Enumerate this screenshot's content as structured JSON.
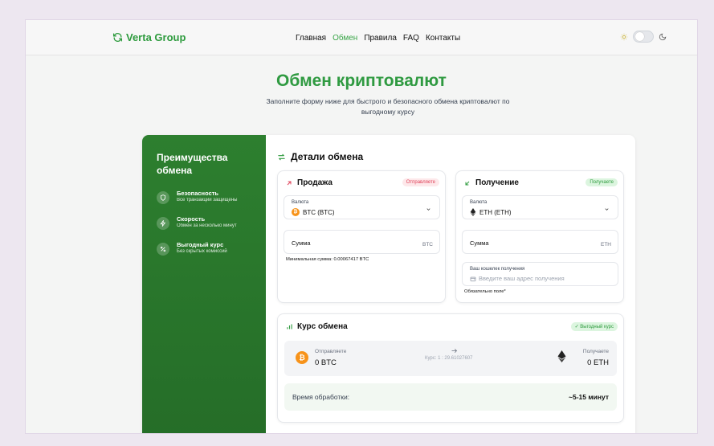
{
  "brand": {
    "name": "Verta Group",
    "color": "#2e9b3e"
  },
  "nav": {
    "items": [
      "Главная",
      "Обмен",
      "Правила",
      "FAQ",
      "Контакты"
    ],
    "active": "Обмен"
  },
  "hero": {
    "title": "Обмен криптовалют",
    "subtitle": "Заполните форму ниже для быстрого и безопасного обмена криптовалют по выгодному курсу"
  },
  "sidebar": {
    "title": "Преимущества обмена",
    "features": [
      {
        "title": "Безопасность",
        "desc": "Все транзакции защищены",
        "icon": "shield-icon"
      },
      {
        "title": "Скорость",
        "desc": "Обмен за несколько минут",
        "icon": "bolt-icon"
      },
      {
        "title": "Выгодный курс",
        "desc": "Без скрытых комиссий",
        "icon": "percent-icon"
      }
    ]
  },
  "details": {
    "title": "Детали обмена",
    "sell": {
      "title": "Продажа",
      "badge": "Отправляете",
      "currency_label": "Валюта",
      "currency_value": "BTC (BTC)",
      "amount_label": "Сумма",
      "amount_unit": "BTC",
      "min_note": "Минимальная сумма: 0.00067417 BTC"
    },
    "receive": {
      "title": "Получение",
      "badge": "Получаете",
      "currency_label": "Валюта",
      "currency_value": "ETH (ETH)",
      "amount_label": "Сумма",
      "amount_unit": "ETH",
      "wallet_label": "Ваш кошелек получения",
      "wallet_placeholder": "Введите ваш адрес получения",
      "required_note": "Обязательно поле*"
    }
  },
  "rate": {
    "title": "Курс обмена",
    "badge": "✓ Выгодный курс",
    "send_label": "Отправляете",
    "send_value": "0 BTC",
    "rate_text": "Курс: 1 : 29.61027607",
    "receive_label": "Получаете",
    "receive_value": "0 ETH",
    "processing_label": "Время обработки:",
    "processing_value": "~5-15 минут"
  }
}
